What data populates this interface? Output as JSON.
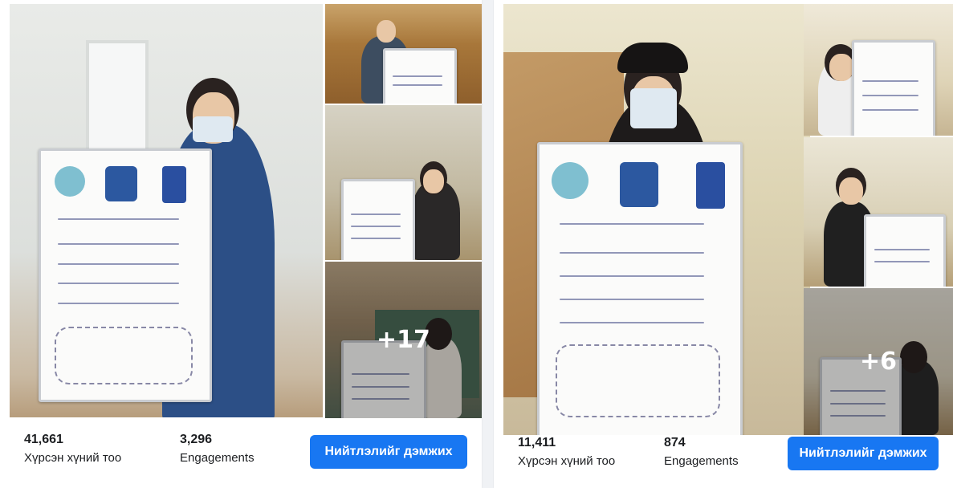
{
  "colors": {
    "accent": "#1877f2",
    "page_bg": "#f0f2f5",
    "text": "#1c1e21"
  },
  "posts": [
    {
      "more_photos": "+17",
      "reach_value": "41,661",
      "reach_label": "Хүрсэн хүний тоо",
      "engagements_value": "3,296",
      "engagements_label": "Engagements",
      "boost_label": "Нийтлэлийг дэмжих"
    },
    {
      "more_photos": "+6",
      "reach_value": "11,411",
      "reach_label": "Хүрсэн хүний тоо",
      "engagements_value": "874",
      "engagements_label": "Engagements",
      "boost_label": "Нийтлэлийг дэмжих"
    }
  ]
}
